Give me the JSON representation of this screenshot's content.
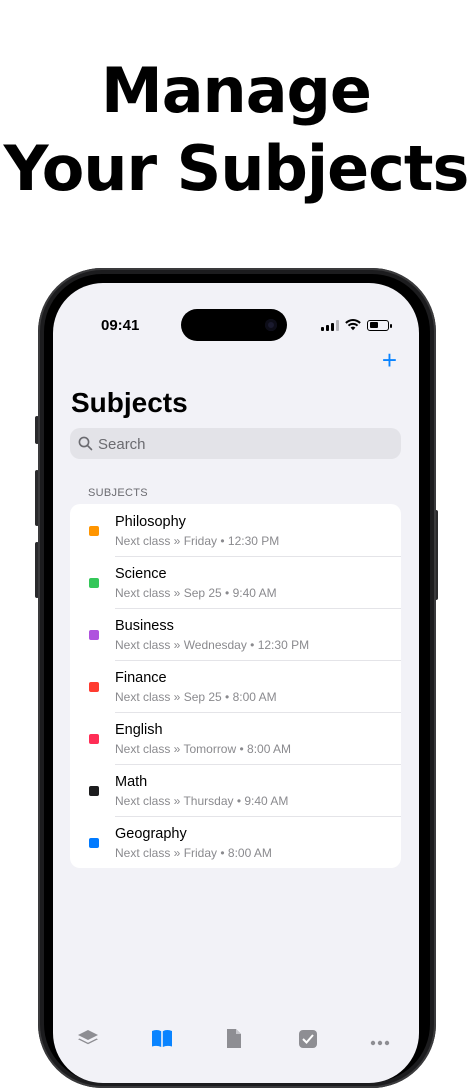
{
  "headline": {
    "line1": "Manage",
    "line2": "Your Subjects"
  },
  "status_bar": {
    "time": "09:41"
  },
  "nav": {
    "add_icon": "plus-icon",
    "title": "Subjects"
  },
  "search": {
    "placeholder": "Search",
    "value": ""
  },
  "section_header": "SUBJECTS",
  "subjects": [
    {
      "name": "Philosophy",
      "next": "Next class » Friday • 12:30 PM",
      "color": "#ff9500"
    },
    {
      "name": "Science",
      "next": "Next class » Sep 25 • 9:40 AM",
      "color": "#34c759"
    },
    {
      "name": "Business",
      "next": "Next class » Wednesday • 12:30 PM",
      "color": "#af52de"
    },
    {
      "name": "Finance",
      "next": "Next class » Sep 25 • 8:00 AM",
      "color": "#ff3b30"
    },
    {
      "name": "English",
      "next": "Next class » Tomorrow • 8:00 AM",
      "color": "#ff2d55"
    },
    {
      "name": "Math",
      "next": "Next class » Thursday • 9:40 AM",
      "color": "#1c1c1e"
    },
    {
      "name": "Geography",
      "next": "Next class » Friday • 8:00 AM",
      "color": "#007aff"
    }
  ],
  "tab_bar": {
    "tabs": [
      {
        "icon": "layers-icon",
        "active": false
      },
      {
        "icon": "book-icon",
        "active": true
      },
      {
        "icon": "document-icon",
        "active": false
      },
      {
        "icon": "checkbox-icon",
        "active": false
      },
      {
        "icon": "more-icon",
        "active": false
      }
    ]
  },
  "colors": {
    "accent": "#0a84ff",
    "background": "#f2f2f7"
  }
}
